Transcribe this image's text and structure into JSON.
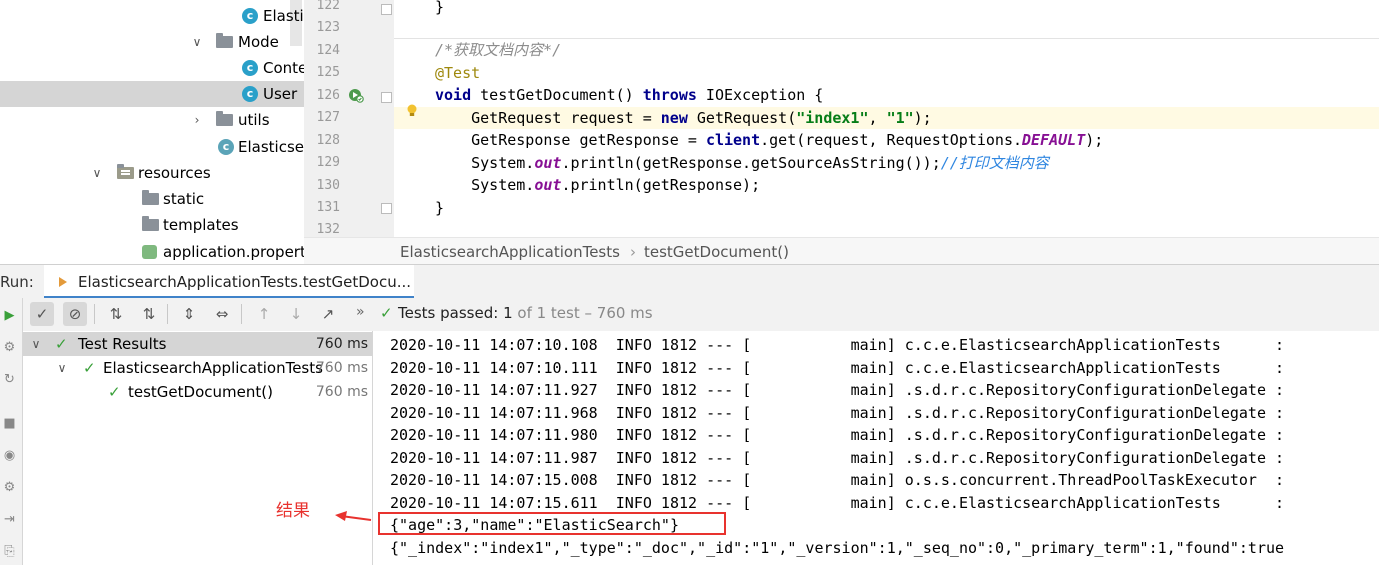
{
  "tree": {
    "items": [
      {
        "label": "Elastic",
        "kind": "class"
      },
      {
        "label": "Mode",
        "kind": "folder"
      },
      {
        "label": "Conte",
        "kind": "class"
      },
      {
        "label": "User",
        "kind": "class"
      },
      {
        "label": "utils",
        "kind": "folder"
      },
      {
        "label": "Elasticsear",
        "kind": "spring-class"
      },
      {
        "label": "resources",
        "kind": "resources-folder"
      },
      {
        "label": "static",
        "kind": "folder"
      },
      {
        "label": "templates",
        "kind": "folder"
      },
      {
        "label": "application.propert",
        "kind": "properties-file"
      }
    ]
  },
  "editor": {
    "line_numbers": [
      "122",
      "123",
      "124",
      "125",
      "126",
      "127",
      "128",
      "129",
      "130",
      "131",
      "132"
    ],
    "code": {
      "l122": "}",
      "l124": "/*获取文档内容*/",
      "l125": "@Test",
      "l126_kw1": "void",
      "l126_a": " testGetDocument() ",
      "l126_kw2": "throws",
      "l126_b": " IOException {",
      "l127_a": "    GetRequest request = ",
      "l127_kw": "new",
      "l127_b": " GetRequest(",
      "l127_s1": "\"index1\"",
      "l127_c": ", ",
      "l127_s2": "\"1\"",
      "l127_d": ");",
      "l128_a": "    GetResponse getResponse = ",
      "l128_kw": "client",
      "l128_b": ".get(request, RequestOptions.",
      "l128_f": "DEFAULT",
      "l128_c": ");",
      "l129_a": "    System.",
      "l129_f": "out",
      "l129_b": ".println(getResponse.getSourceAsString());",
      "l129_cm": "//打印文档内容",
      "l130_a": "    System.",
      "l130_f": "out",
      "l130_b": ".println(getResponse);",
      "l131": "}"
    }
  },
  "breadcrumb": {
    "class_name": "ElasticsearchApplicationTests",
    "separator": "›",
    "method_name": "testGetDocument()"
  },
  "run": {
    "label": "Run:",
    "tab_label": "ElasticsearchApplicationTests.testGetDocu...",
    "status_prefix": "Tests passed:",
    "status_count": "1",
    "status_suffix": "of 1 test – 760 ms"
  },
  "results": {
    "rows": [
      {
        "label": "Test Results",
        "time": "760 ms"
      },
      {
        "label": "ElasticsearchApplicationTests",
        "time": "760 ms"
      },
      {
        "label": "testGetDocument()",
        "time": "760 ms"
      }
    ]
  },
  "console": {
    "log_lines": [
      "2020-10-11 14:07:10.108  INFO 1812 --- [           main] c.c.e.ElasticsearchApplicationTests      :",
      "2020-10-11 14:07:10.111  INFO 1812 --- [           main] c.c.e.ElasticsearchApplicationTests      :",
      "2020-10-11 14:07:11.927  INFO 1812 --- [           main] .s.d.r.c.RepositoryConfigurationDelegate :",
      "2020-10-11 14:07:11.968  INFO 1812 --- [           main] .s.d.r.c.RepositoryConfigurationDelegate :",
      "2020-10-11 14:07:11.980  INFO 1812 --- [           main] .s.d.r.c.RepositoryConfigurationDelegate :",
      "2020-10-11 14:07:11.987  INFO 1812 --- [           main] .s.d.r.c.RepositoryConfigurationDelegate :",
      "2020-10-11 14:07:15.008  INFO 1812 --- [           main] o.s.s.concurrent.ThreadPoolTaskExecutor  :",
      "2020-10-11 14:07:15.611  INFO 1812 --- [           main] c.c.e.ElasticsearchApplicationTests      :"
    ],
    "result_line": "{\"age\":3,\"name\":\"ElasticSearch\"}",
    "response_line": "{\"_index\":\"index1\",\"_type\":\"_doc\",\"_id\":\"1\",\"_version\":1,\"_seq_no\":0,\"_primary_term\":1,\"found\":true"
  },
  "annotation": {
    "label": "结果",
    "color": "#e8322e"
  }
}
